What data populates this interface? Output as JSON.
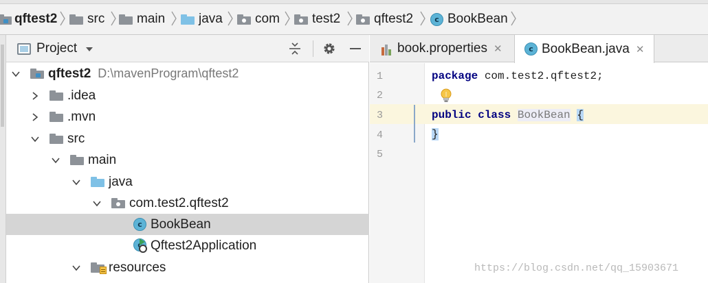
{
  "breadcrumb": {
    "items": [
      {
        "label": "qftest2",
        "icon": "module-folder-icon"
      },
      {
        "label": "src",
        "icon": "folder-icon"
      },
      {
        "label": "main",
        "icon": "folder-icon"
      },
      {
        "label": "java",
        "icon": "source-folder-icon"
      },
      {
        "label": "com",
        "icon": "package-icon"
      },
      {
        "label": "test2",
        "icon": "package-icon"
      },
      {
        "label": "qftest2",
        "icon": "package-icon"
      },
      {
        "label": "BookBean",
        "icon": "class-icon"
      }
    ]
  },
  "project_panel": {
    "title": "Project",
    "tree": [
      {
        "label": "qftest2",
        "path": "D:\\mavenProgram\\qftest2",
        "expanded": true,
        "icon": "module-folder-icon"
      },
      {
        "label": ".idea",
        "expanded": false,
        "icon": "folder-icon"
      },
      {
        "label": ".mvn",
        "expanded": false,
        "icon": "folder-icon"
      },
      {
        "label": "src",
        "expanded": true,
        "icon": "folder-icon"
      },
      {
        "label": "main",
        "expanded": true,
        "icon": "folder-icon"
      },
      {
        "label": "java",
        "expanded": true,
        "icon": "source-folder-icon"
      },
      {
        "label": "com.test2.qftest2",
        "expanded": true,
        "icon": "package-icon"
      },
      {
        "label": "BookBean",
        "selected": true,
        "icon": "class-icon"
      },
      {
        "label": "Qftest2Application",
        "icon": "spring-app-class-icon"
      },
      {
        "label": "resources",
        "expanded": true,
        "icon": "resources-folder-icon"
      }
    ]
  },
  "editor": {
    "tabs": [
      {
        "label": "book.properties",
        "icon": "properties-file-icon",
        "active": false
      },
      {
        "label": "BookBean.java",
        "icon": "class-icon",
        "active": true
      }
    ],
    "line_numbers": [
      "1",
      "2",
      "3",
      "4",
      "5"
    ],
    "code": {
      "line1_keyword": "package",
      "line1_rest": " com.test2.qftest2;",
      "line3_kw1": "public",
      "line3_kw2": "class",
      "line3_class": "BookBean",
      "line3_brace": "{",
      "line4_brace": "}"
    },
    "class_icon_letter": "c",
    "current_line": 3
  },
  "watermark": "https://blog.csdn.net/qq_15903671",
  "colors": {
    "keyword": "#000080",
    "caret_line": "#fbf6de",
    "selection_row": "#d5d5d5",
    "brace_match": "#b9d8f6",
    "class_icon": "#5cb3d6"
  }
}
